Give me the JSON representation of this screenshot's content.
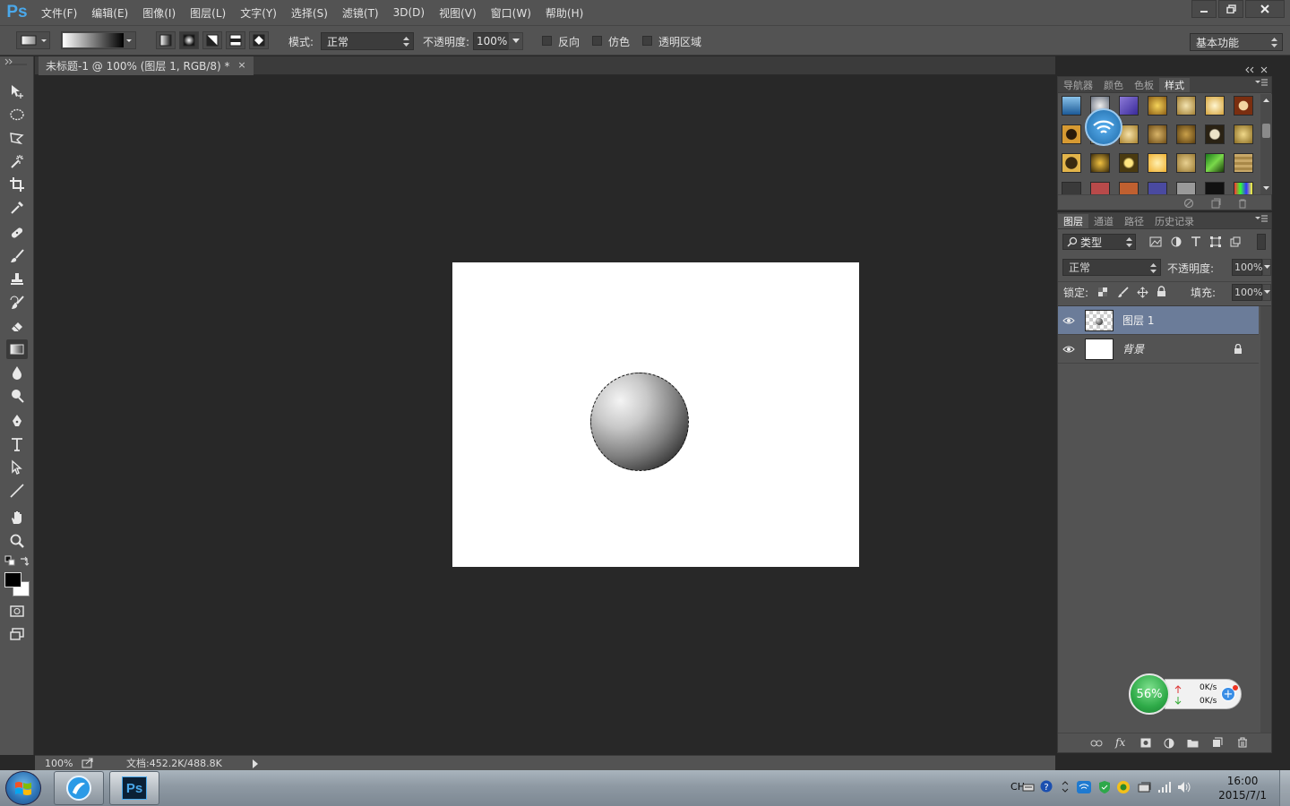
{
  "app": {
    "logo": "Ps",
    "menus": [
      "文件(F)",
      "编辑(E)",
      "图像(I)",
      "图层(L)",
      "文字(Y)",
      "选择(S)",
      "滤镜(T)",
      "3D(D)",
      "视图(V)",
      "窗口(W)",
      "帮助(H)"
    ]
  },
  "options": {
    "mode_label": "模式:",
    "mode_value": "正常",
    "opacity_label": "不透明度:",
    "opacity_value": "100%",
    "reverse_label": "反向",
    "dither_label": "仿色",
    "transparency_label": "透明区域",
    "workspace": "基本功能"
  },
  "document": {
    "tab_title": "未标题-1 @ 100% (图层 1, RGB/8) *",
    "close": "×"
  },
  "status": {
    "zoom": "100%",
    "doc_info": "文档:452.2K/488.8K"
  },
  "styles_panel": {
    "tabs": [
      "导航器",
      "颜色",
      "色板",
      "样式"
    ]
  },
  "layers_panel": {
    "tabs": [
      "图层",
      "通道",
      "路径",
      "历史记录"
    ],
    "filter": "类型",
    "blend_mode": "正常",
    "opacity_label": "不透明度:",
    "opacity_value": "100%",
    "lock_label": "锁定:",
    "fill_label": "填充:",
    "fill_value": "100%",
    "layers": [
      {
        "name": "图层 1"
      },
      {
        "name": "背景"
      }
    ],
    "bottom_fx": "fx"
  },
  "net_widget": {
    "percent": "56%",
    "up": "0K/s",
    "down": "0K/s"
  },
  "taskbar": {
    "lang": "CH",
    "time": "16:00",
    "date": "2015/7/1"
  },
  "colors": {
    "ps_blue": "#4aa8ea",
    "selected_layer": "#6b7c99",
    "ui_gray": "#535353"
  }
}
